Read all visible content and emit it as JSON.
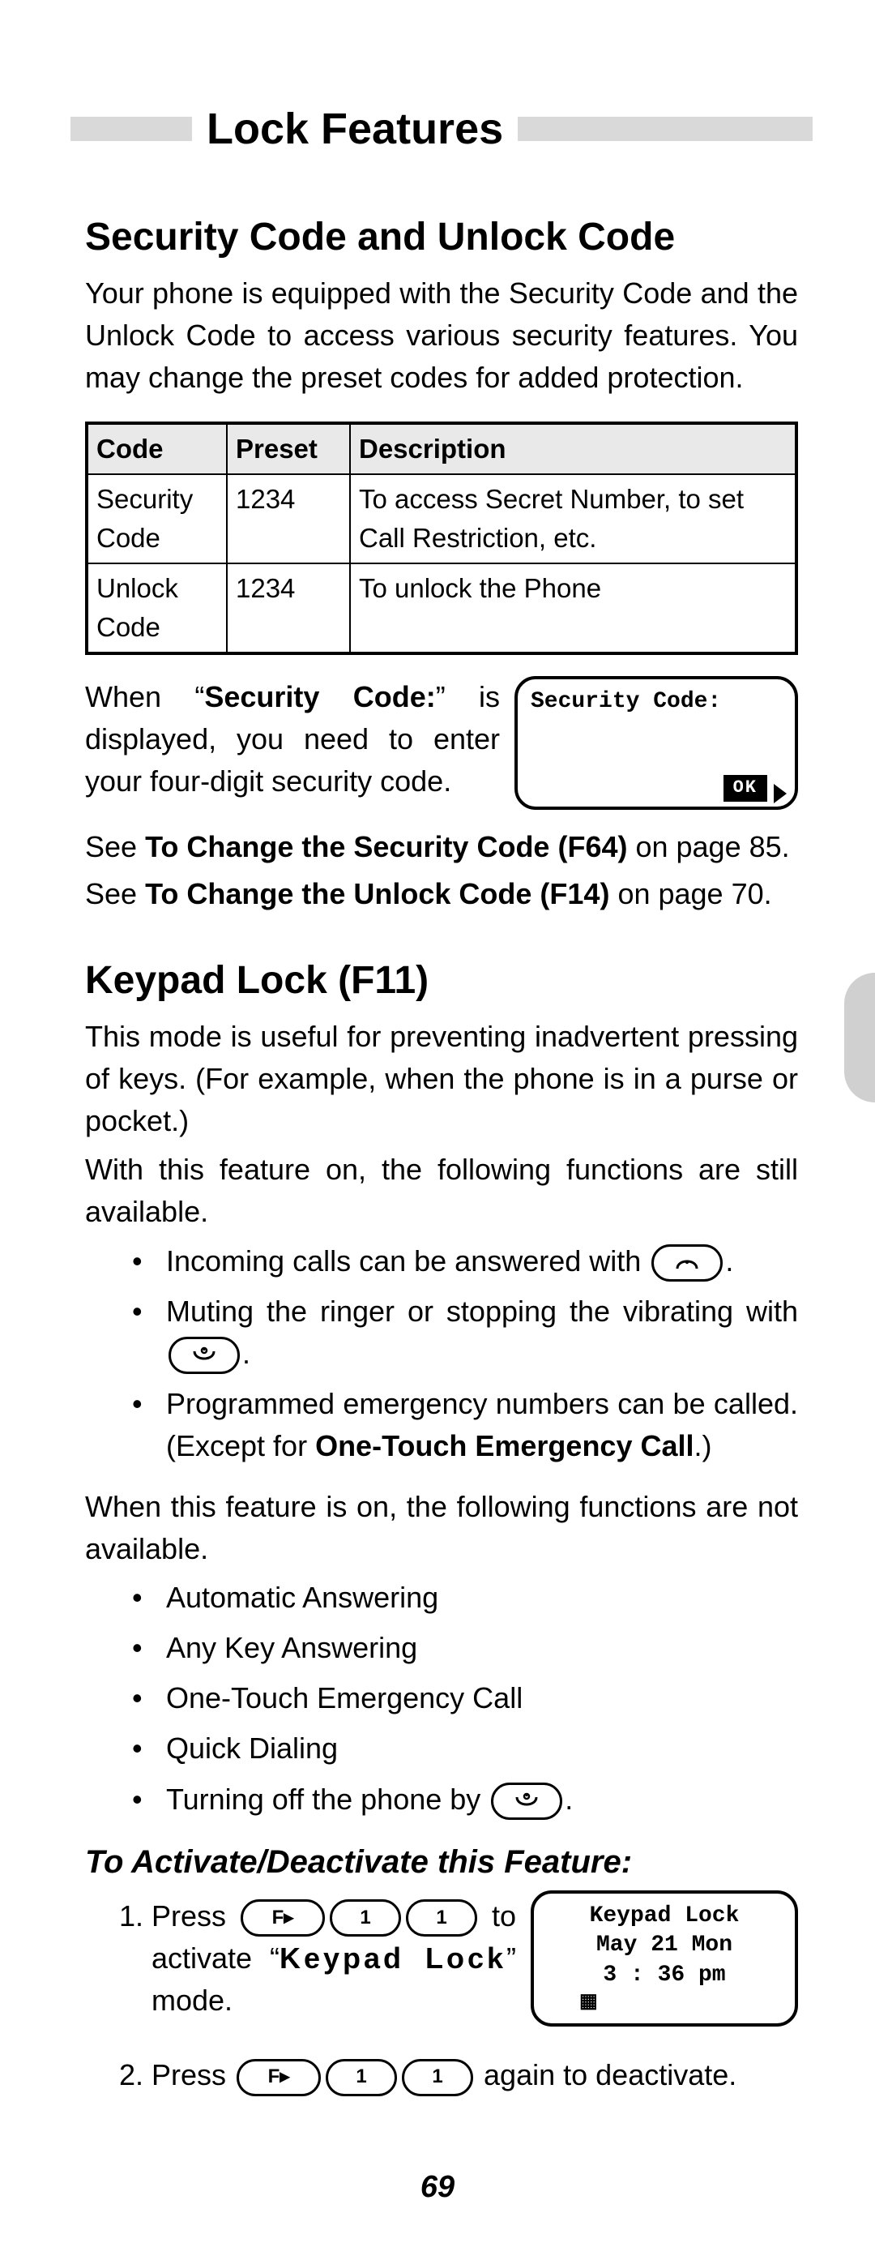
{
  "title": "Lock Features",
  "section1": {
    "heading": "Security Code and Unlock Code",
    "intro": "Your phone is equipped with the Security Code and the Unlock Code to access various security features. You may change the preset codes for added protection."
  },
  "table": {
    "headers": {
      "code": "Code",
      "preset": "Preset",
      "desc": "Description"
    },
    "rows": [
      {
        "code": "Security Code",
        "preset": "1234",
        "desc": "To access Secret Number, to set Call Restriction, etc."
      },
      {
        "code": "Unlock Code",
        "preset": "1234",
        "desc": "To unlock the Phone"
      }
    ]
  },
  "secEntry": {
    "pre": "When “",
    "bold": "Security Code:",
    "post": "” is displayed, you need to enter your four-digit security code."
  },
  "screen1": {
    "text": "Security Code:",
    "ok": "OK"
  },
  "refs": {
    "l1a": "See ",
    "l1b": "To Change the Security Code (F64)",
    "l1c": " on page 85.",
    "l2a": "See ",
    "l2b": "To Change the Unlock Code (F14)",
    "l2c": " on page 70."
  },
  "section2": {
    "heading": "Keypad Lock (F11)",
    "intro": "This mode is useful for preventing inadvertent pressing of keys. (For example, when the phone is in a purse or pocket.)",
    "lead1": "With this feature on, the following functions are still available.",
    "bullets1": {
      "a1": "Incoming calls can be answered with ",
      "a2": ".",
      "b1": "Muting the ringer or stopping the vibrating with ",
      "b2": ".",
      "c1": "Programmed emergency numbers can be called. (Except for ",
      "cBold": "One-Touch Emergency Call",
      "c2": ".)"
    },
    "lead2": "When this feature is on, the following functions are not available.",
    "bullets2": [
      "Automatic Answering",
      "Any Key Answering",
      "One-Touch Emergency Call",
      "Quick Dialing"
    ],
    "turnOff1": "Turning off the phone by ",
    "turnOff2": "."
  },
  "activate": {
    "heading": "To Activate/Deactivate this Feature:",
    "step1a": "Press ",
    "step1b": " to activate “",
    "step1Bold": "Keypad Lock",
    "step1c": "” mode.",
    "step2a": "Press ",
    "step2b": " again to deactivate."
  },
  "keys": {
    "F": "F▸",
    "one": "1"
  },
  "screen2": {
    "t": "Keypad Lock",
    "d": "May 21 Mon",
    "h": "3 : 36 pm"
  },
  "pageNumber": "69"
}
